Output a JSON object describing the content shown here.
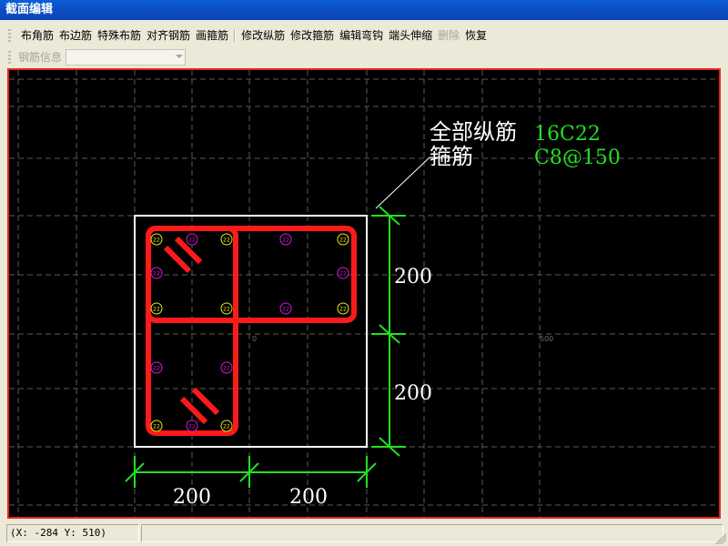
{
  "window": {
    "title": "截面编辑"
  },
  "toolbar1": {
    "buttons": [
      {
        "label": "布角筋",
        "enabled": true
      },
      {
        "label": "布边筋",
        "enabled": true
      },
      {
        "label": "特殊布筋",
        "enabled": true
      },
      {
        "label": "对齐钢筋",
        "enabled": true
      },
      {
        "label": "画箍筋",
        "enabled": true
      },
      {
        "label": "修改纵筋",
        "enabled": true
      },
      {
        "label": "修改箍筋",
        "enabled": true
      },
      {
        "label": "编辑弯钩",
        "enabled": true
      },
      {
        "label": "端头伸缩",
        "enabled": true
      },
      {
        "label": "删除",
        "enabled": false
      },
      {
        "label": "恢复",
        "enabled": true
      }
    ]
  },
  "toolbar2": {
    "rebar_info_label": "钢筋信息",
    "rebar_info_value": ""
  },
  "drawing": {
    "annotation_longitudinal_label": "全部纵筋",
    "annotation_longitudinal_value": "16C22",
    "annotation_stirrup_label": "箍筋",
    "annotation_stirrup_value": "C8@150",
    "dimension_vertical_top": "200",
    "dimension_vertical_bottom": "200",
    "dimension_horizontal_left": "200",
    "dimension_horizontal_right": "200",
    "grid_label_origin": "0",
    "grid_label_500": "500",
    "bar_marker_label": "22",
    "colors": {
      "background": "#000000",
      "outline": "#ffffff",
      "stirrup": "#ff1a1a",
      "dimension": "#22e022",
      "corner_bar": "#e8e81a",
      "side_bar": "#d61ad6",
      "grid": "#5a5a5a"
    }
  },
  "status": {
    "coordinates": "(X: -284 Y: 510)",
    "message": ""
  }
}
